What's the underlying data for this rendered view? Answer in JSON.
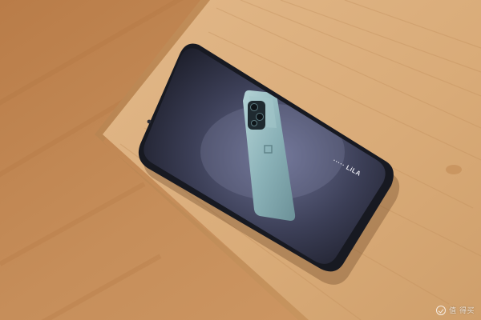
{
  "scene": {
    "subject": "phone-on-wooden-table",
    "colors": {
      "floor": "#c48a55",
      "table": "#dcb07c",
      "phone_body": "#161821",
      "wallpaper_dark": "#1a1a26",
      "wallpaper_light": "#6a6f90",
      "featured_phone": "#8eb7bd"
    }
  },
  "screen": {
    "overlay_text": "·····  LiLA"
  },
  "watermark": {
    "icon": "checkmark-circle-icon",
    "text": "值 得买"
  }
}
